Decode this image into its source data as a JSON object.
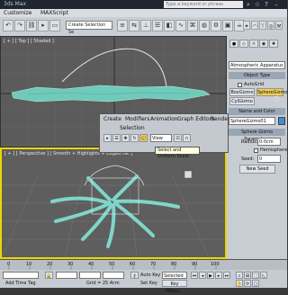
{
  "window": {
    "title": "3ds Max",
    "search_placeholder": "Type a keyword or phrase"
  },
  "menu": [
    "Customize",
    "MAXScript"
  ],
  "toolbar": {
    "selection_set_placeholder": "Create Selection Se"
  },
  "viewports": {
    "top_label": "[ + ] [ Top ] [ Shaded ]",
    "persp_label": "[ + ] [ Perspective ] [ Smooth + Highlights + Edged Fac ]"
  },
  "command_panel": {
    "category": "Atmospheric Apparatus",
    "object_type_header": "Object Type",
    "autogrid_label": "AutoGrid",
    "buttons": [
      "BoxGizmo",
      "SphereGizmo",
      "CylGizmo"
    ],
    "name_color_header": "Name and Color",
    "name_value": "SphereGizmo01",
    "params_header": "Sphere Gizmo Parameters",
    "radius_label": "Radius:",
    "radius_value": "0.0cm",
    "hemisphere_label": "Hemisphere",
    "seed_label": "Seed:",
    "seed_value": "0",
    "new_seed_label": "New Seed"
  },
  "ribbon": {
    "tabs": [
      "Create",
      "Modifiers",
      "Animation",
      "Graph Editors",
      "Rende"
    ],
    "selection_label": "Selection",
    "view_dropdown": "View",
    "tooltip": "Select and Uniform Scale"
  },
  "timeline": {
    "ticks": [
      "0",
      "10",
      "20",
      "30",
      "40",
      "50",
      "60",
      "70",
      "80",
      "90",
      "100"
    ]
  },
  "status": {
    "grid_label": "Grid = 25.4cm",
    "auto_key_label": "Auto Key",
    "selected_label": "Selected",
    "set_key_label": "Set Key",
    "key_filters_label": "Key Filters...",
    "add_time_tag_label": "Add Time Tag"
  },
  "colors": {
    "accent_viewport_border": "#e8d800",
    "object_color": "#7fd6c8"
  }
}
